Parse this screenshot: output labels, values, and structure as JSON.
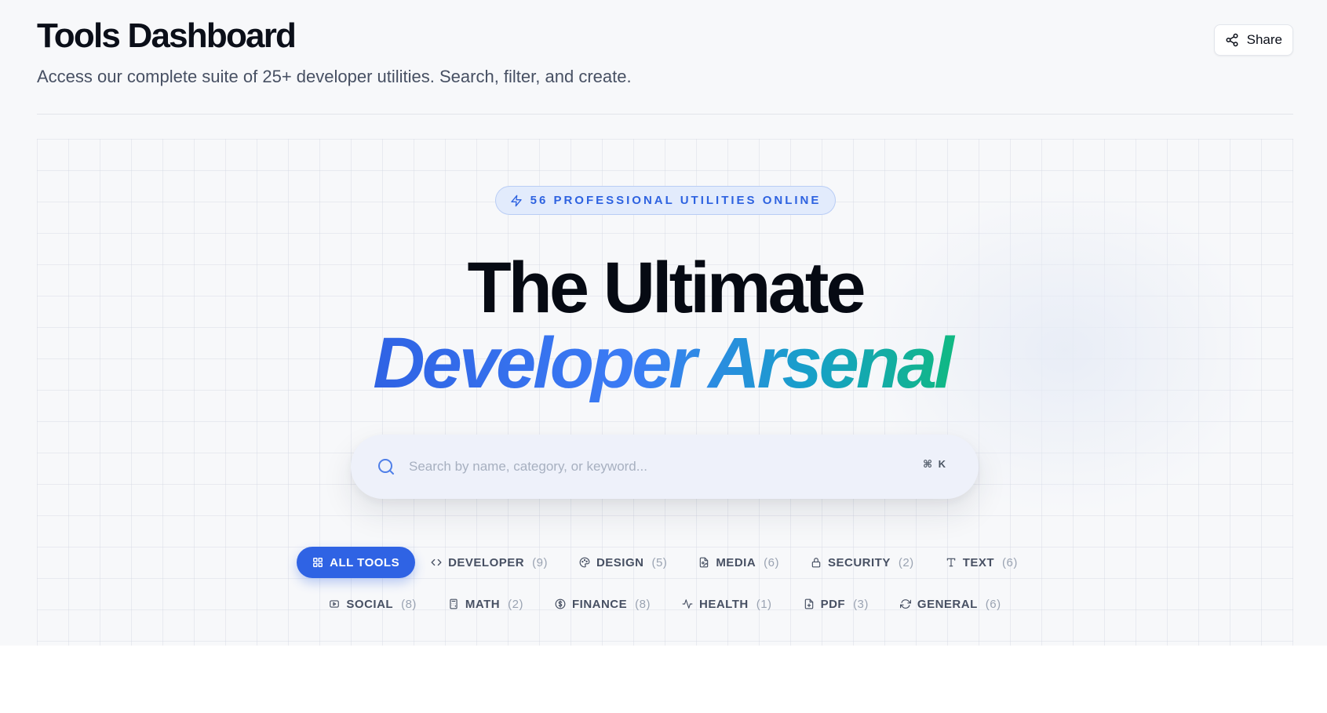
{
  "header": {
    "title": "Tools Dashboard",
    "subtitle": "Access our complete suite of 25+ developer utilities. Search, filter, and create.",
    "share_label": "Share"
  },
  "hero": {
    "badge": "56 PROFESSIONAL UTILITIES ONLINE",
    "headline_line1": "The Ultimate",
    "headline_line2": "Developer Arsenal"
  },
  "search": {
    "placeholder": "Search by name, category, or keyword...",
    "value": "",
    "shortcut": "⌘ K"
  },
  "categories": [
    {
      "label": "ALL TOOLS",
      "count": "",
      "icon": "grid-icon",
      "active": true
    },
    {
      "label": "DEVELOPER",
      "count": "(9)",
      "icon": "code-icon"
    },
    {
      "label": "DESIGN",
      "count": "(5)",
      "icon": "palette-icon"
    },
    {
      "label": "MEDIA",
      "count": "(6)",
      "icon": "image-file-icon"
    },
    {
      "label": "SECURITY",
      "count": "(2)",
      "icon": "lock-icon"
    },
    {
      "label": "TEXT",
      "count": "(6)",
      "icon": "type-icon"
    },
    {
      "label": "SOCIAL",
      "count": "(8)",
      "icon": "video-icon"
    },
    {
      "label": "MATH",
      "count": "(2)",
      "icon": "calculator-icon"
    },
    {
      "label": "FINANCE",
      "count": "(8)",
      "icon": "dollar-icon"
    },
    {
      "label": "HEALTH",
      "count": "(1)",
      "icon": "activity-icon"
    },
    {
      "label": "PDF",
      "count": "(3)",
      "icon": "file-plus-icon"
    },
    {
      "label": "GENERAL",
      "count": "(6)",
      "icon": "refresh-icon"
    }
  ],
  "colors": {
    "accent": "#2f63e4",
    "gradient_end": "#10b981",
    "background": "#f7f8fa"
  }
}
